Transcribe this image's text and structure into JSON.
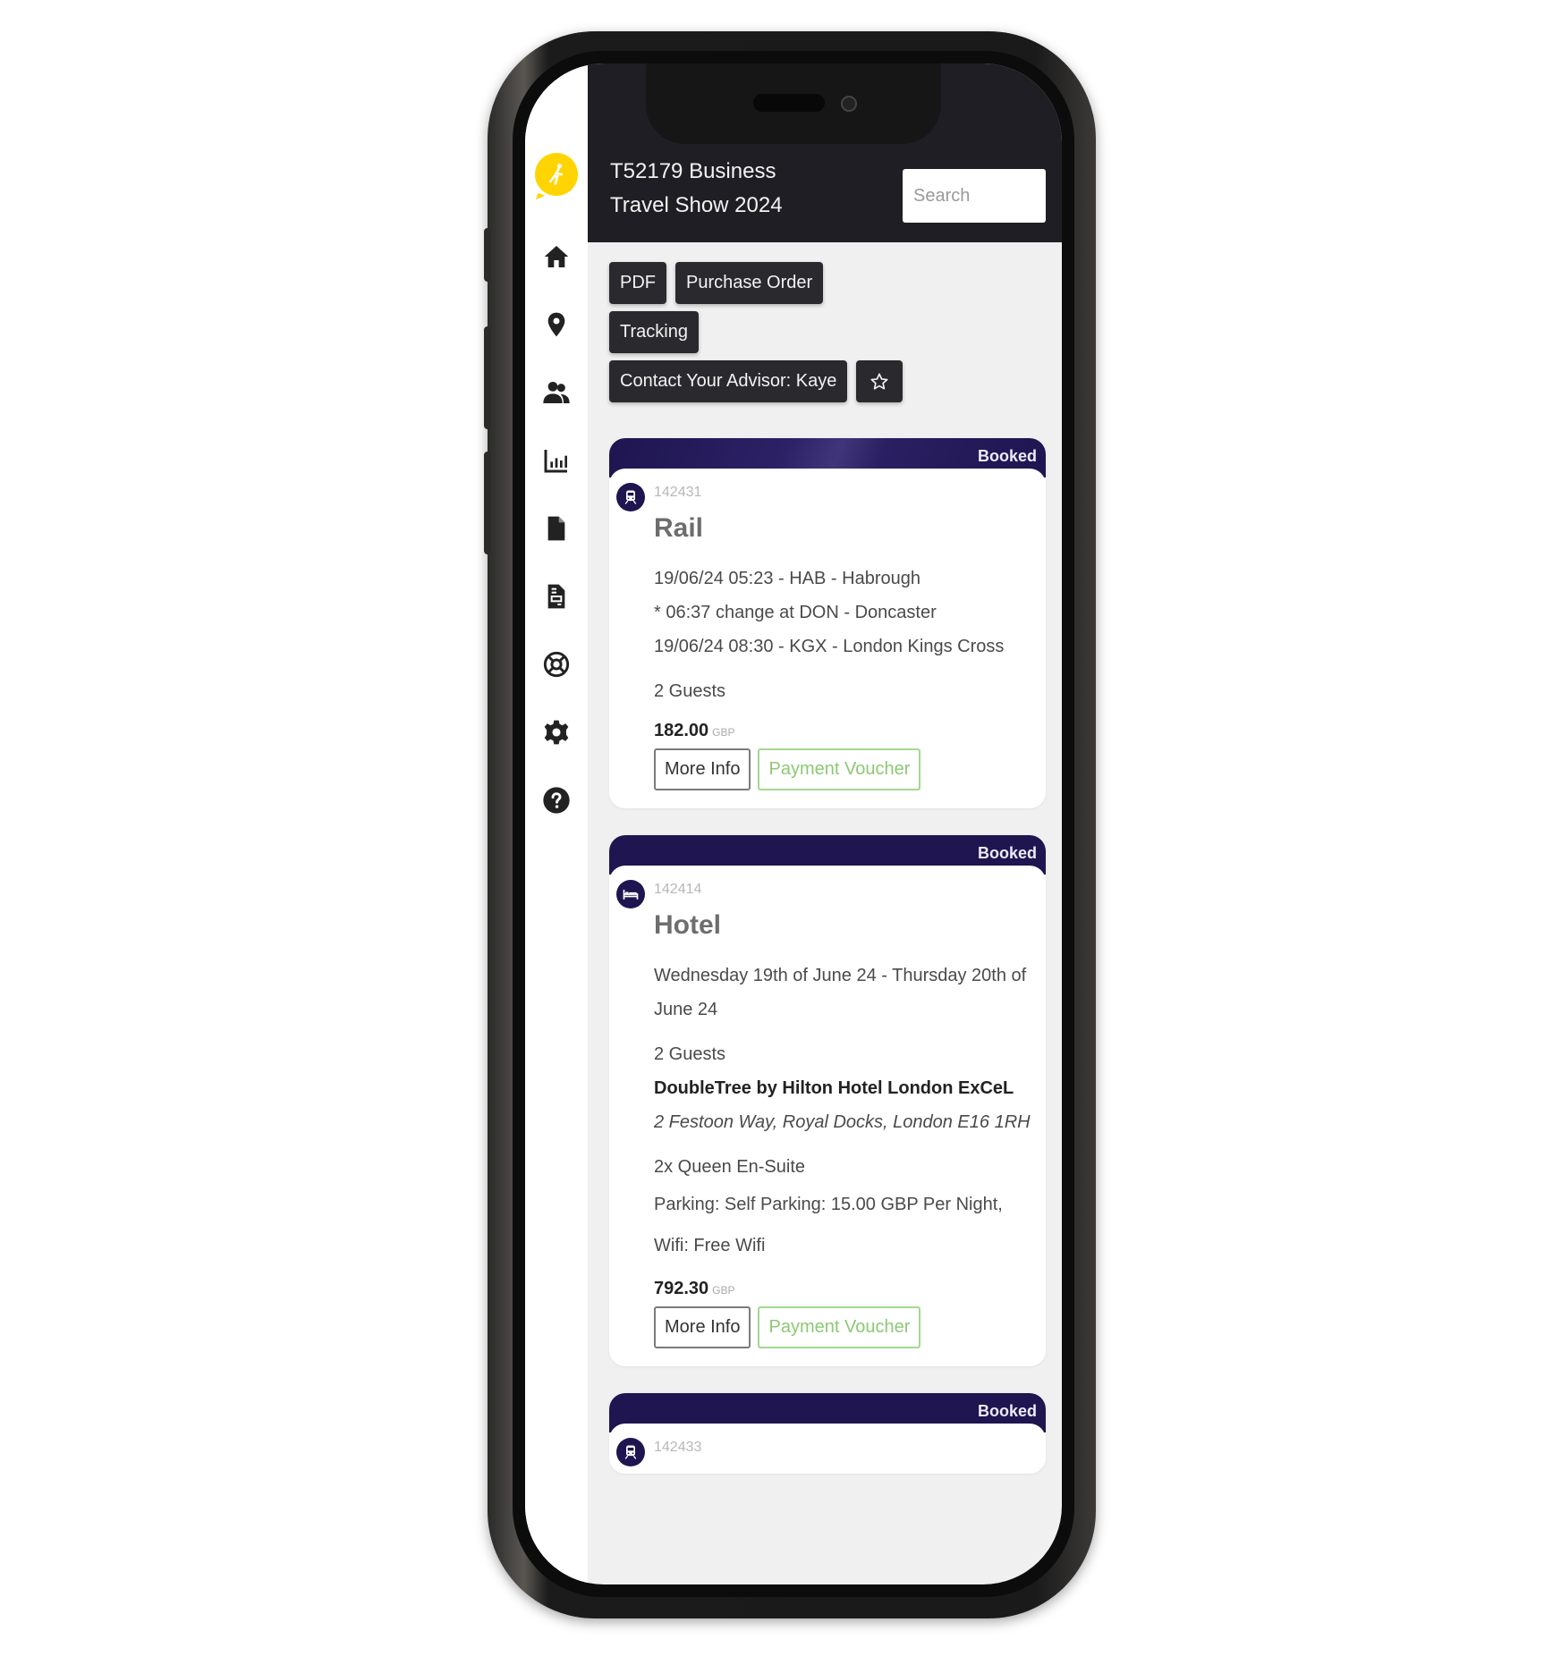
{
  "app": {
    "title_line1": "T52179 Business",
    "title_line2": "Travel Show 2024",
    "search_placeholder": "Search",
    "brand_color": "#ffd400",
    "accent_color": "#1f1550"
  },
  "sidebar": {
    "items": [
      {
        "icon": "home-icon"
      },
      {
        "icon": "location-pin-icon"
      },
      {
        "icon": "users-icon"
      },
      {
        "icon": "chart-icon"
      },
      {
        "icon": "document-icon"
      },
      {
        "icon": "invoice-icon"
      },
      {
        "icon": "lifebuoy-icon"
      },
      {
        "icon": "gear-icon"
      },
      {
        "icon": "help-icon"
      }
    ]
  },
  "actions": {
    "pdf": "PDF",
    "purchase_order": "Purchase Order",
    "tracking": "Tracking",
    "contact": "Contact Your Advisor: Kaye",
    "favourite_icon": "star-icon"
  },
  "bookings": [
    {
      "status": "Booked",
      "ref": "142431",
      "type": "Rail",
      "icon": "train-icon",
      "lines": [
        "19/06/24 05:23 - HAB - Habrough",
        "* 06:37 change at DON - Doncaster",
        "19/06/24 08:30 - KGX - London Kings Cross"
      ],
      "guests": "2 Guests",
      "price": "182.00",
      "currency": "GBP",
      "more_info": "More Info",
      "voucher": "Payment Voucher"
    },
    {
      "status": "Booked",
      "ref": "142414",
      "type": "Hotel",
      "icon": "bed-icon",
      "dates": "Wednesday 19th of June 24 - Thursday 20th of June 24",
      "guests": "2 Guests",
      "hotel_name": "DoubleTree by Hilton Hotel London ExCeL",
      "address": "2 Festoon Way, Royal Docks, London E16 1RH",
      "room": "2x Queen En-Suite",
      "amenities": "Parking: Self Parking: 15.00 GBP Per Night, Wifi: Free Wifi",
      "price": "792.30",
      "currency": "GBP",
      "more_info": "More Info",
      "voucher": "Payment Voucher"
    },
    {
      "status": "Booked",
      "ref": "142433",
      "icon": "train-icon"
    }
  ]
}
